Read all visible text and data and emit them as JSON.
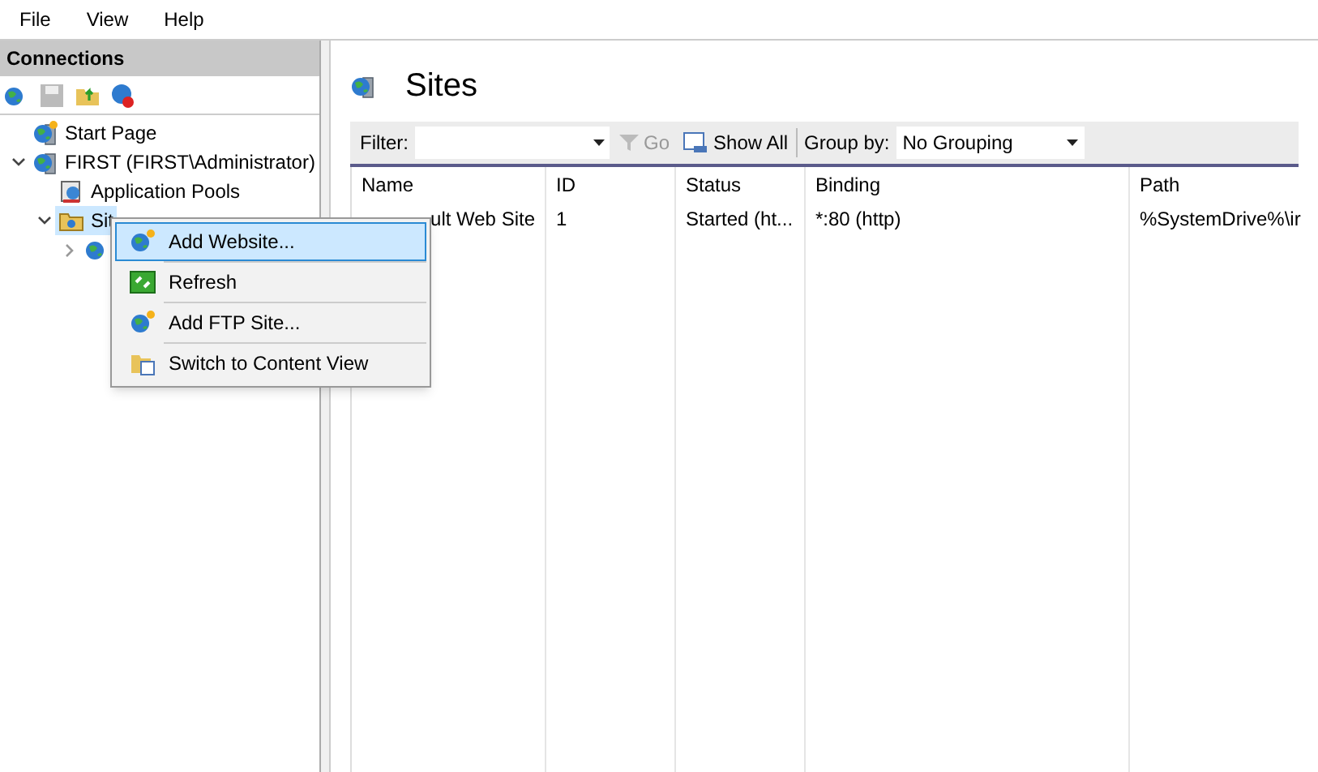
{
  "menu_bar": [
    "File",
    "View",
    "Help"
  ],
  "connections": {
    "title": "Connections",
    "tree": [
      {
        "label": "Start Page",
        "kind": "start",
        "selected": false
      },
      {
        "label": "FIRST (FIRST\\Administrator)",
        "kind": "server",
        "selected": false,
        "expanded": true,
        "children": [
          {
            "label": "Application Pools",
            "kind": "pools",
            "selected": false
          },
          {
            "label": "Sit",
            "kind": "folder",
            "selected": true,
            "expanded": true,
            "children": [
              {
                "kind": "globe",
                "selected": false,
                "expanded": false
              }
            ]
          }
        ]
      }
    ]
  },
  "content": {
    "title": "Sites",
    "toolbar": {
      "filter_label": "Filter:",
      "go": "Go",
      "show_all": "Show All",
      "group_by_label": "Group by:",
      "group_by_value": "No Grouping"
    },
    "table": {
      "columns": [
        "Name",
        "ID",
        "Status",
        "Binding",
        "Path"
      ],
      "rows": [
        [
          "ult Web Site",
          "1",
          "Started (ht...",
          "*:80 (http)",
          "%SystemDrive%\\ir"
        ]
      ]
    }
  },
  "context_menu": [
    {
      "label": "Add Website...",
      "kind": "add",
      "selected": true
    },
    {
      "label": "Refresh",
      "kind": "refresh",
      "selected": false
    },
    {
      "label": "Add FTP Site...",
      "kind": "add",
      "selected": false
    },
    {
      "label": "Switch to Content View",
      "kind": "content",
      "selected": false
    }
  ]
}
